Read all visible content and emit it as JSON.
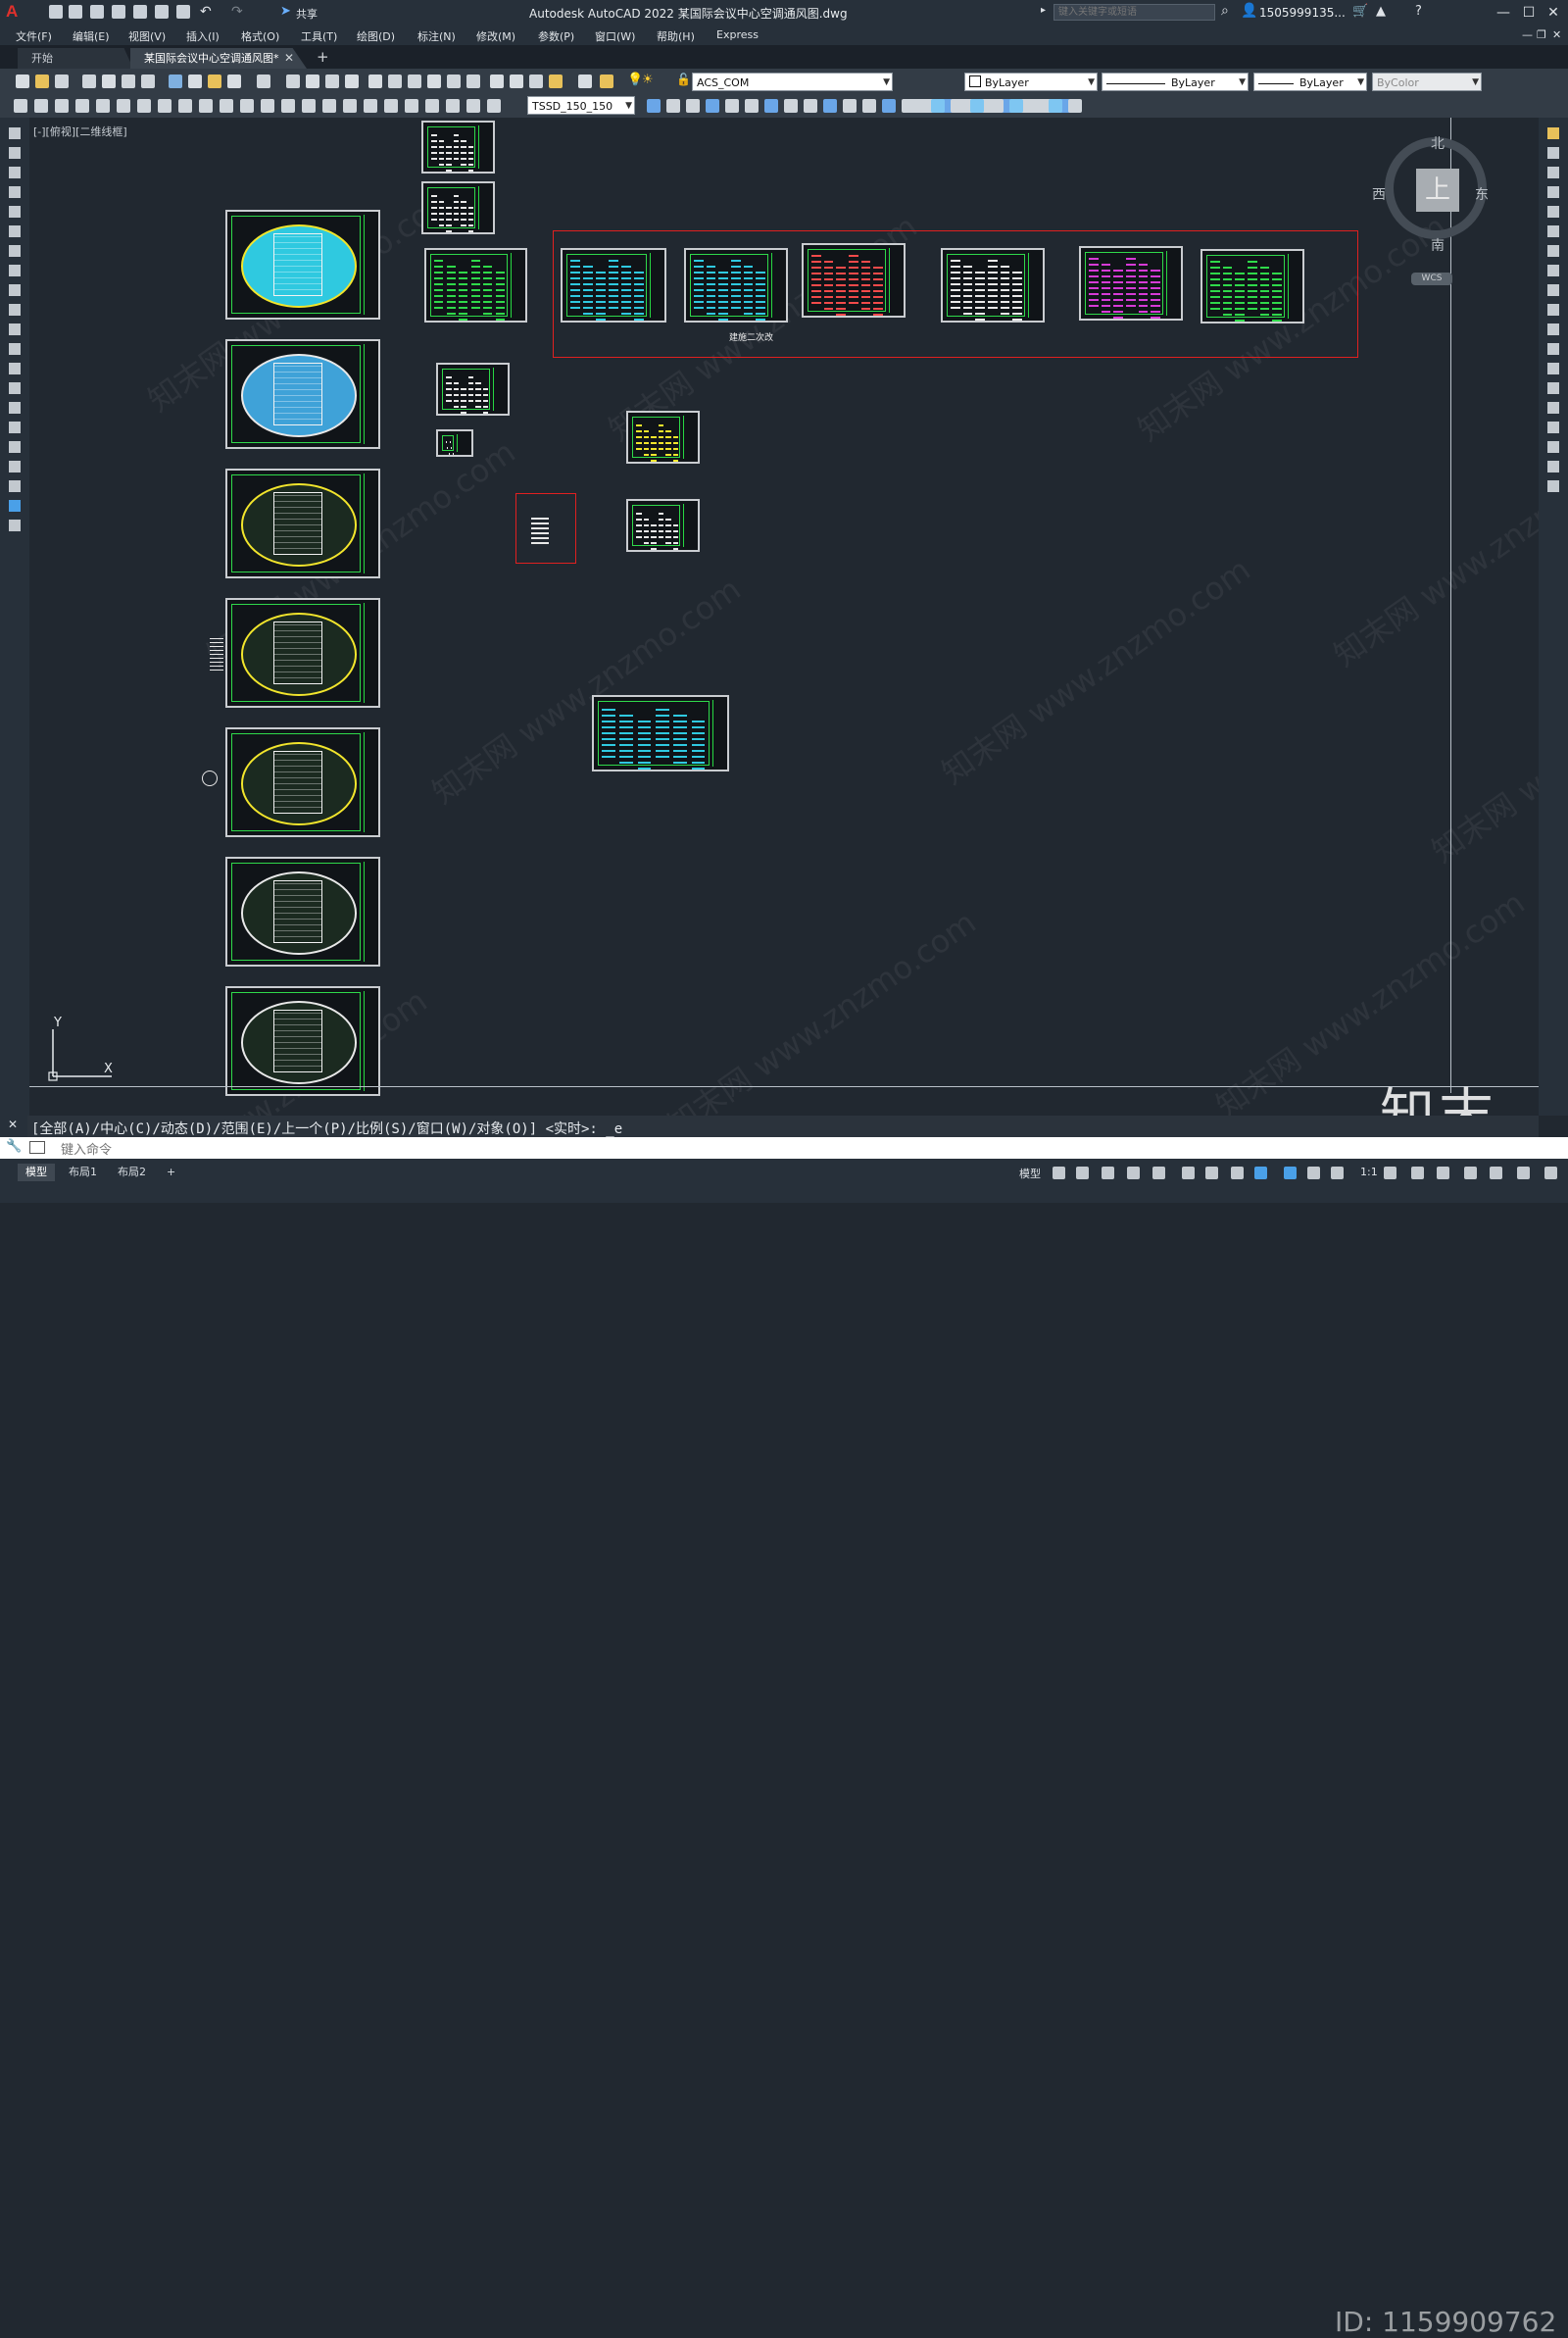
{
  "titlebar": {
    "app_logo": "A",
    "share_label": "共享",
    "title": "Autodesk AutoCAD 2022    某国际会议中心空调通风图.dwg",
    "search_placeholder": "键入关键字或短语",
    "user": "1505999135...",
    "minimize": "—",
    "restore": "☐",
    "close": "✕"
  },
  "menu": [
    "文件(F)",
    "编辑(E)",
    "视图(V)",
    "插入(I)",
    "格式(O)",
    "工具(T)",
    "绘图(D)",
    "标注(N)",
    "修改(M)",
    "参数(P)",
    "窗口(W)",
    "帮助(H)",
    "Express"
  ],
  "tabs": {
    "start": "开始",
    "file": "某国际会议中心空调通风图*",
    "close": "✕",
    "add": "+"
  },
  "toolbar": {
    "layer": "ACS_COM",
    "color": "ByLayer",
    "linetype": "ByLayer",
    "lineweight": "ByLayer",
    "plotstyle": "ByColor",
    "style_combo": "TSSD_150_150"
  },
  "canvas": {
    "viewport_label": "[-][俯视][二维线框]",
    "annotation": "建施二次改",
    "watermark": "知末网 www.znzmo.com",
    "logo": "知末",
    "id_text": "ID: 1159909762"
  },
  "viewcube": {
    "north": "北",
    "south": "南",
    "east": "东",
    "west": "西",
    "top": "上",
    "wcs": "WCS"
  },
  "ucs": {
    "x": "X",
    "y": "Y"
  },
  "command": {
    "history": "[全部(A)/中心(C)/动态(D)/范围(E)/上一个(P)/比例(S)/窗口(W)/对象(O)] <实时>: _e",
    "placeholder": "键入命令"
  },
  "status": {
    "layout_tabs": [
      "模型",
      "布局1",
      "布局2"
    ],
    "add": "+",
    "mode": "模型",
    "scale": "1:1"
  },
  "colors": {
    "accent_red": "#e02020",
    "frame_green": "#2fd94a",
    "cyan": "#2fc9e0",
    "yellow": "#f2e52c",
    "magenta": "#d63bd6"
  }
}
